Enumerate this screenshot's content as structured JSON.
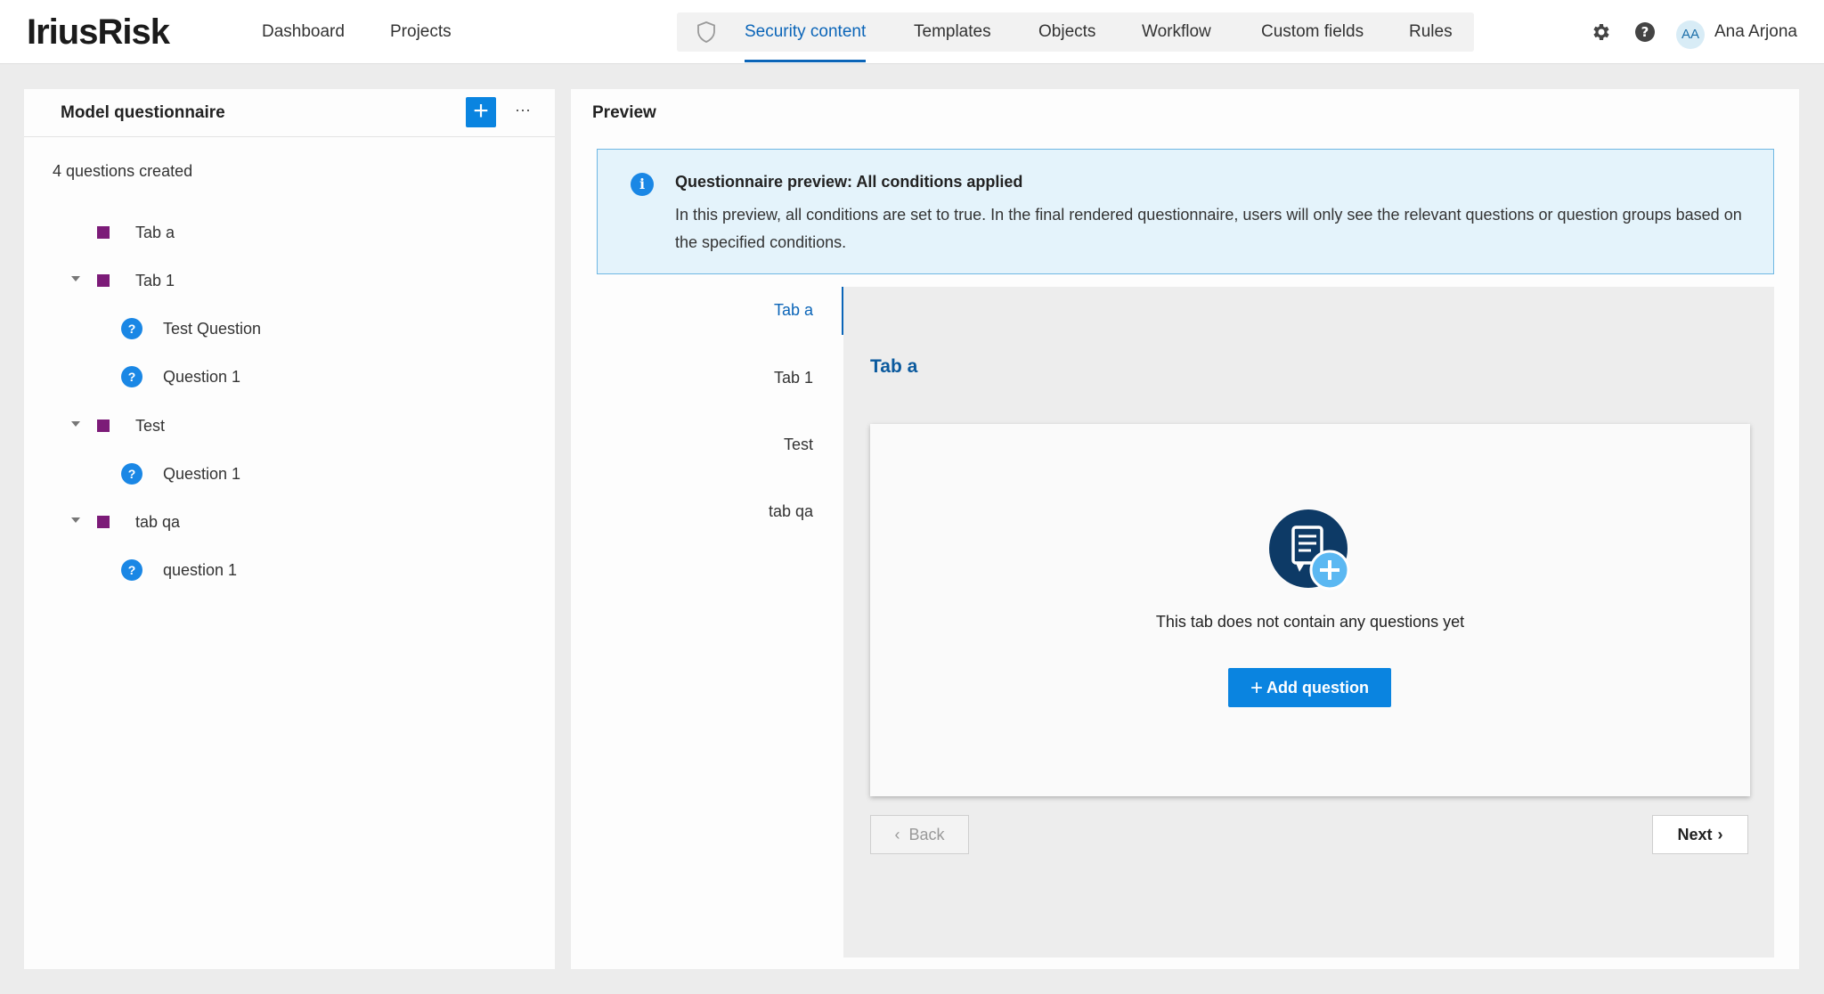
{
  "header": {
    "logo": "IriusRisk",
    "nav": {
      "dashboard": "Dashboard",
      "projects": "Projects"
    },
    "content_tabs": [
      {
        "label": "Security content",
        "active": true
      },
      {
        "label": "Templates"
      },
      {
        "label": "Objects"
      },
      {
        "label": "Workflow"
      },
      {
        "label": "Custom fields"
      },
      {
        "label": "Rules"
      }
    ],
    "user": {
      "initials": "AA",
      "name": "Ana Arjona"
    }
  },
  "left": {
    "title": "Model questionnaire",
    "add_label": "+",
    "more_label": "···",
    "count": "4 questions created",
    "tree": [
      {
        "type": "tab",
        "label": "Tab a",
        "expandable": false
      },
      {
        "type": "tab",
        "label": "Tab 1",
        "expandable": true
      },
      {
        "type": "question",
        "label": "Test Question"
      },
      {
        "type": "question",
        "label": "Question 1"
      },
      {
        "type": "tab",
        "label": "Test",
        "expandable": true
      },
      {
        "type": "question",
        "label": "Question 1"
      },
      {
        "type": "tab",
        "label": "tab qa",
        "expandable": true
      },
      {
        "type": "question",
        "label": "question 1"
      }
    ]
  },
  "preview": {
    "title": "Preview",
    "info": {
      "icon": "info-icon",
      "title": "Questionnaire preview: All conditions applied",
      "body": "In this preview, all conditions are set to true. In the final rendered questionnaire, users will only see the relevant questions or question groups based on the specified conditions."
    },
    "tabs": [
      {
        "label": "Tab a",
        "active": true
      },
      {
        "label": "Tab 1"
      },
      {
        "label": "Test"
      },
      {
        "label": "tab qa"
      }
    ],
    "active_tab_heading": "Tab a",
    "empty_text": "This tab does not contain any questions yet",
    "add_question": "Add question",
    "back": "Back",
    "next": "Next"
  },
  "colors": {
    "accent": "#0a84e0",
    "active_text": "#0b65b8",
    "tab_square": "#7c1b78",
    "info_bg": "#e4f3fb"
  }
}
